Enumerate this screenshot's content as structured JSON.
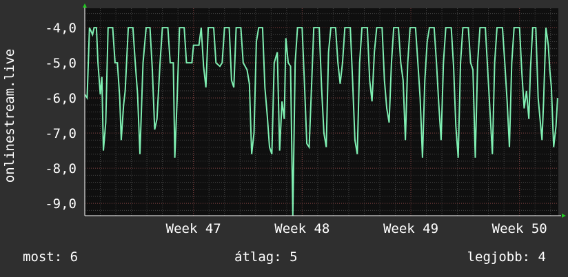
{
  "chart_data": {
    "type": "line",
    "ylabel": "onlinestream.live",
    "ylim": [
      -9.35,
      -3.45
    ],
    "y_ticks": [
      "-4,0",
      "-5,0",
      "-6,0",
      "-7,0",
      "-8,0",
      "-9,0"
    ],
    "y_tick_values": [
      -4,
      -5,
      -6,
      -7,
      -8,
      -9
    ],
    "x_ticks": [
      {
        "label": "Week 47",
        "pos": 7
      },
      {
        "label": "Week 48",
        "pos": 14
      },
      {
        "label": "Week 49",
        "pos": 21
      },
      {
        "label": "Week 50",
        "pos": 28
      }
    ],
    "xlim": [
      0,
      30.5
    ],
    "grid": true,
    "colors": {
      "line": "#7fefb2",
      "background": "#0f0f0f",
      "grid_minor": "#444444",
      "grid_major": "#7a3b3b",
      "axis_arrow": "#22cc22"
    },
    "series": [
      {
        "values": [
          [
            0.0,
            -5.9
          ],
          [
            0.15,
            -6.0
          ],
          [
            0.3,
            -4.0
          ],
          [
            0.5,
            -4.2
          ],
          [
            0.6,
            -4.0
          ],
          [
            0.75,
            -4.0
          ],
          [
            0.85,
            -5.0
          ],
          [
            1.0,
            -5.9
          ],
          [
            1.1,
            -5.4
          ],
          [
            1.2,
            -7.5
          ],
          [
            1.35,
            -6.7
          ],
          [
            1.5,
            -4.0
          ],
          [
            1.8,
            -4.0
          ],
          [
            1.95,
            -5.0
          ],
          [
            2.1,
            -5.0
          ],
          [
            2.25,
            -6.0
          ],
          [
            2.35,
            -7.2
          ],
          [
            2.5,
            -6.2
          ],
          [
            2.6,
            -5.8
          ],
          [
            2.8,
            -4.0
          ],
          [
            3.1,
            -4.0
          ],
          [
            3.25,
            -5.0
          ],
          [
            3.4,
            -5.9
          ],
          [
            3.55,
            -7.6
          ],
          [
            3.75,
            -5.0
          ],
          [
            3.95,
            -4.0
          ],
          [
            4.2,
            -4.0
          ],
          [
            4.35,
            -5.2
          ],
          [
            4.5,
            -6.9
          ],
          [
            4.65,
            -6.6
          ],
          [
            4.85,
            -5.0
          ],
          [
            5.0,
            -4.0
          ],
          [
            5.35,
            -4.0
          ],
          [
            5.5,
            -5.0
          ],
          [
            5.7,
            -5.0
          ],
          [
            5.8,
            -7.7
          ],
          [
            5.95,
            -6.0
          ],
          [
            6.1,
            -4.0
          ],
          [
            6.4,
            -4.0
          ],
          [
            6.55,
            -5.0
          ],
          [
            6.75,
            -5.0
          ],
          [
            6.9,
            -5.0
          ],
          [
            7.0,
            -4.5
          ],
          [
            7.2,
            -4.5
          ],
          [
            7.35,
            -4.5
          ],
          [
            7.5,
            -4.0
          ],
          [
            7.65,
            -5.1
          ],
          [
            7.8,
            -5.7
          ],
          [
            7.95,
            -4.0
          ],
          [
            8.3,
            -4.0
          ],
          [
            8.45,
            -5.0
          ],
          [
            8.7,
            -5.1
          ],
          [
            8.85,
            -5.0
          ],
          [
            9.0,
            -4.0
          ],
          [
            9.3,
            -4.0
          ],
          [
            9.45,
            -5.5
          ],
          [
            9.6,
            -5.7
          ],
          [
            9.75,
            -4.0
          ],
          [
            10.05,
            -4.0
          ],
          [
            10.2,
            -5.0
          ],
          [
            10.45,
            -5.2
          ],
          [
            10.6,
            -5.6
          ],
          [
            10.75,
            -7.6
          ],
          [
            10.9,
            -7.0
          ],
          [
            11.05,
            -4.4
          ],
          [
            11.2,
            -4.0
          ],
          [
            11.45,
            -4.0
          ],
          [
            11.6,
            -5.7
          ],
          [
            11.75,
            -6.5
          ],
          [
            11.9,
            -7.4
          ],
          [
            12.05,
            -7.6
          ],
          [
            12.2,
            -5.0
          ],
          [
            12.4,
            -4.7
          ],
          [
            12.55,
            -7.5
          ],
          [
            12.7,
            -6.1
          ],
          [
            12.85,
            -6.6
          ],
          [
            12.95,
            -4.3
          ],
          [
            13.1,
            -5.0
          ],
          [
            13.25,
            -5.1
          ],
          [
            13.4,
            -9.35
          ],
          [
            13.55,
            -5.0
          ],
          [
            13.7,
            -4.0
          ],
          [
            14.0,
            -4.0
          ],
          [
            14.15,
            -5.6
          ],
          [
            14.3,
            -7.3
          ],
          [
            14.45,
            -7.4
          ],
          [
            14.6,
            -5.7
          ],
          [
            14.75,
            -4.0
          ],
          [
            15.1,
            -4.0
          ],
          [
            15.25,
            -5.7
          ],
          [
            15.4,
            -7.0
          ],
          [
            15.55,
            -7.4
          ],
          [
            15.7,
            -4.7
          ],
          [
            15.85,
            -4.0
          ],
          [
            16.15,
            -4.0
          ],
          [
            16.3,
            -5.0
          ],
          [
            16.45,
            -5.6
          ],
          [
            16.6,
            -5.0
          ],
          [
            16.75,
            -4.0
          ],
          [
            17.1,
            -4.0
          ],
          [
            17.25,
            -5.5
          ],
          [
            17.4,
            -7.2
          ],
          [
            17.55,
            -7.6
          ],
          [
            17.7,
            -5.0
          ],
          [
            17.85,
            -4.0
          ],
          [
            18.2,
            -4.0
          ],
          [
            18.35,
            -5.5
          ],
          [
            18.5,
            -6.1
          ],
          [
            18.65,
            -4.7
          ],
          [
            18.8,
            -4.0
          ],
          [
            19.15,
            -4.0
          ],
          [
            19.3,
            -5.5
          ],
          [
            19.45,
            -6.3
          ],
          [
            19.6,
            -6.7
          ],
          [
            19.75,
            -5.0
          ],
          [
            19.9,
            -4.0
          ],
          [
            20.2,
            -4.0
          ],
          [
            20.35,
            -5.0
          ],
          [
            20.5,
            -5.5
          ],
          [
            20.65,
            -7.2
          ],
          [
            20.8,
            -5.0
          ],
          [
            20.95,
            -4.0
          ],
          [
            21.3,
            -4.0
          ],
          [
            21.45,
            -5.0
          ],
          [
            21.6,
            -6.0
          ],
          [
            21.75,
            -7.7
          ],
          [
            21.9,
            -5.5
          ],
          [
            22.05,
            -4.4
          ],
          [
            22.2,
            -4.0
          ],
          [
            22.5,
            -4.0
          ],
          [
            22.65,
            -5.0
          ],
          [
            22.8,
            -6.2
          ],
          [
            22.95,
            -7.2
          ],
          [
            23.1,
            -5.0
          ],
          [
            23.25,
            -4.0
          ],
          [
            23.6,
            -4.0
          ],
          [
            23.75,
            -5.1
          ],
          [
            23.9,
            -6.8
          ],
          [
            24.05,
            -7.7
          ],
          [
            24.2,
            -5.0
          ],
          [
            24.35,
            -4.0
          ],
          [
            24.7,
            -4.0
          ],
          [
            24.85,
            -5.0
          ],
          [
            25.0,
            -5.2
          ],
          [
            25.15,
            -7.7
          ],
          [
            25.3,
            -5.0
          ],
          [
            25.45,
            -4.0
          ],
          [
            25.8,
            -4.0
          ],
          [
            25.95,
            -5.2
          ],
          [
            26.1,
            -6.4
          ],
          [
            26.25,
            -7.6
          ],
          [
            26.4,
            -5.0
          ],
          [
            26.55,
            -4.0
          ],
          [
            26.9,
            -4.0
          ],
          [
            27.05,
            -5.0
          ],
          [
            27.2,
            -6.1
          ],
          [
            27.35,
            -7.4
          ],
          [
            27.5,
            -5.0
          ],
          [
            27.65,
            -4.0
          ],
          [
            28.0,
            -4.0
          ],
          [
            28.15,
            -5.3
          ],
          [
            28.3,
            -6.3
          ],
          [
            28.45,
            -5.8
          ],
          [
            28.6,
            -6.6
          ],
          [
            28.7,
            -5.2
          ],
          [
            28.85,
            -4.0
          ],
          [
            29.05,
            -4.0
          ],
          [
            29.2,
            -6.0
          ],
          [
            29.3,
            -6.5
          ],
          [
            29.45,
            -7.2
          ],
          [
            29.55,
            -6.1
          ],
          [
            29.7,
            -4.0
          ],
          [
            29.85,
            -4.5
          ],
          [
            29.95,
            -5.2
          ],
          [
            30.05,
            -5.7
          ],
          [
            30.2,
            -7.4
          ],
          [
            30.35,
            -6.8
          ],
          [
            30.45,
            -6.0
          ]
        ]
      }
    ]
  },
  "footer": {
    "current": "most: 6",
    "average": "átlag: 5",
    "best": "legjobb: 4"
  }
}
